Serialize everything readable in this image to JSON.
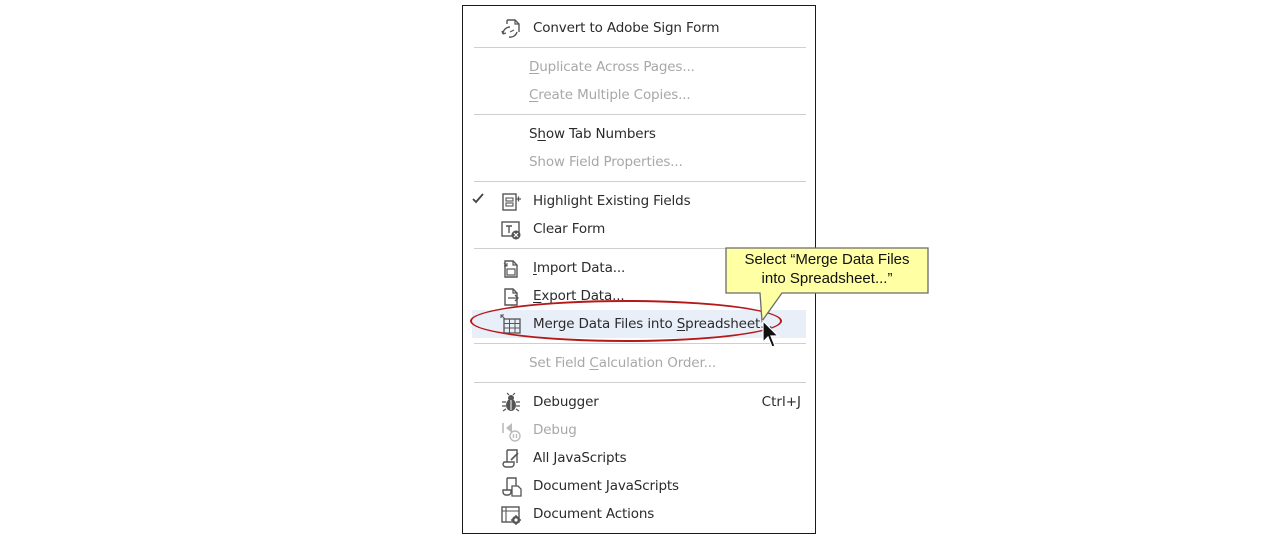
{
  "menu": {
    "items": [
      {
        "id": "convert",
        "label": "Convert to Adobe Sign Form",
        "icon": "adobe-sign-icon"
      },
      {
        "id": "duplicate",
        "label_parts": [
          "",
          "D",
          "uplicate Across Pages..."
        ]
      },
      {
        "id": "create",
        "label_parts": [
          "",
          "C",
          "reate Multiple Copies..."
        ]
      },
      {
        "id": "show_tab",
        "label_parts": [
          "S",
          "h",
          "ow Tab Numbers"
        ]
      },
      {
        "id": "show_field",
        "label": "Show Field Properties..."
      },
      {
        "id": "highlight",
        "label": "Highlight Existing Fields",
        "icon": "highlight-fields-icon",
        "checked": true
      },
      {
        "id": "clear",
        "label": "Clear Form",
        "icon": "clear-form-icon"
      },
      {
        "id": "import",
        "label_parts": [
          "",
          "I",
          "mport Data..."
        ],
        "icon": "import-data-icon"
      },
      {
        "id": "export",
        "label_parts": [
          "",
          "E",
          "xport Data..."
        ],
        "icon": "export-data-icon"
      },
      {
        "id": "merge",
        "label_parts": [
          "Merge Data Files into ",
          "S",
          "preadsheet..."
        ],
        "icon": "spreadsheet-icon"
      },
      {
        "id": "set_calc",
        "label_parts": [
          "Set Field ",
          "C",
          "alculation Order..."
        ]
      },
      {
        "id": "debugger",
        "label": "Debugger",
        "shortcut": "Ctrl+J",
        "icon": "bug-icon"
      },
      {
        "id": "debug",
        "label": "Debug",
        "icon": "debug-icon"
      },
      {
        "id": "all_js",
        "label": "All JavaScripts",
        "icon": "javascript-icon"
      },
      {
        "id": "doc_js",
        "label": "Document JavaScripts",
        "icon": "document-javascript-icon"
      },
      {
        "id": "doc_actions",
        "label": "Document Actions",
        "icon": "document-actions-icon"
      }
    ]
  },
  "callout": {
    "line1": "Select “Merge Data Files",
    "line2": "into Spreadsheet...”"
  },
  "colors": {
    "highlight_ellipse": "#b51a1a",
    "callout_fill": "#ffffa3",
    "hover_bg": "#e9eff8",
    "disabled_text": "#a8a8a8"
  }
}
